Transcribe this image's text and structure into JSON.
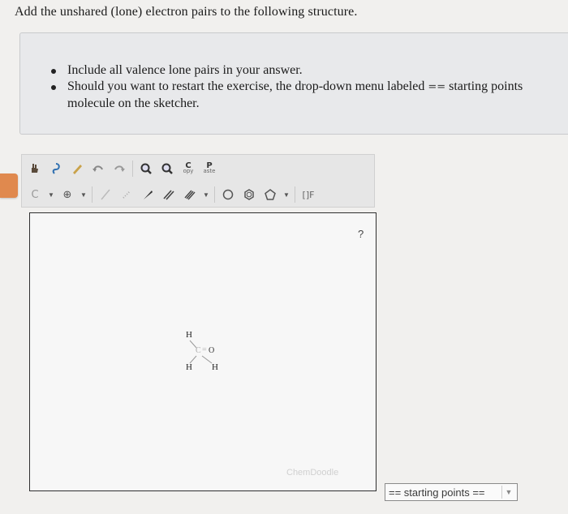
{
  "question": "Add the unshared (lone) electron pairs to the following structure.",
  "instructions": {
    "bullet1": "Include all valence lone pairs in your answer.",
    "bullet2_pre": "Should you want to restart the exercise, the drop-down menu labeled",
    "bullet2_glyph": "==",
    "bullet2_post": "starting points",
    "bullet2_line2": "molecule on the sketcher."
  },
  "toolbar": {
    "copy_top": "C",
    "copy_sub": "opy",
    "paste_top": "P",
    "paste_sub": "aste",
    "c_atom": "C",
    "plus_label": "⊕",
    "bracket_label": "[]F"
  },
  "canvas": {
    "help": "?",
    "watermark": "ChemDoodle",
    "molecule": {
      "h_top": "H",
      "carbon": "C",
      "bond": "=",
      "oxygen": "O",
      "h_left": "H",
      "h_right": "H"
    }
  },
  "dropdown": {
    "value": "== starting points =="
  }
}
